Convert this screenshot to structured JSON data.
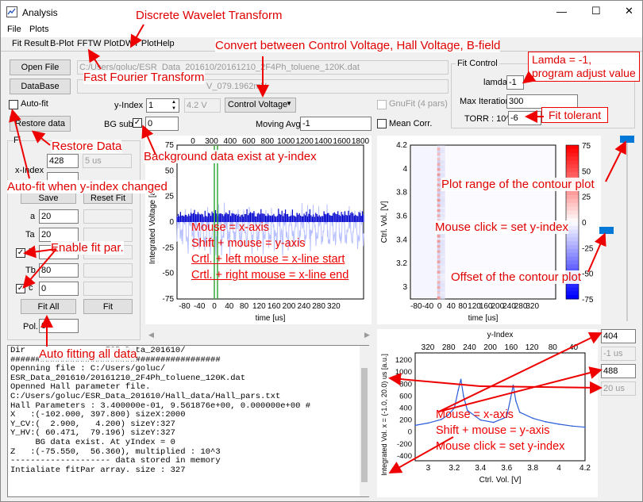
{
  "window": {
    "title": "Analysis",
    "minimize": "—",
    "maximize": "☐",
    "close": "✕"
  },
  "menu": [
    "File",
    "Plots"
  ],
  "tabs": [
    "Fit Result",
    "B-Plot",
    "FFTW Plot",
    "DWT Plot",
    "Help"
  ],
  "controls": {
    "open_file": "Open File",
    "open_file_path": "C:/Users/goluc/ESR_Data_201610/20161210_2F4Ph_toluene_120K.dat",
    "database": "DataBase",
    "database_text": "V_079.1962mV",
    "autofit": "Auto-fit",
    "restore_data": "Restore data",
    "y_index_label": "y-Index",
    "y_index_value": "1",
    "y_index_voltage": "4.2 V",
    "mode_select": "Control Voltage",
    "gnufit": "GnuFit (4 pars)",
    "bg_sub_label": "BG sub.",
    "bg_sub_value": "0",
    "moving_avg_label": "Moving Avg.",
    "moving_avg_value": "-1",
    "mean_corr": "Mean Corr.",
    "x_index_label": "x-Index",
    "x_index_value": "428",
    "x_index_time": "5 us",
    "save": "Save",
    "reset": "Reset Fit",
    "fit_panel_label": "Fi",
    "par_a_label": "a",
    "par_a": "20",
    "par_Ta_label": "Ta",
    "par_Ta": "20",
    "par_b_label": "b",
    "par_Tb_label": "Tb",
    "par_Tb": "80",
    "par_c_label": "c",
    "par_c": "0",
    "fit_all": "Fit All",
    "fit": "Fit",
    "pol_label": "Pol.",
    "pol_value": "0"
  },
  "fit_control": {
    "title": "Fit Control",
    "lamda_label": "lamda",
    "lamda_value": "-1",
    "max_iter_label": "Max Iteration",
    "max_iter_value": "300",
    "torr_label": "TORR : 10^",
    "torr_value": "-6"
  },
  "right_controls": {
    "top_value": "404",
    "top_time": "-1 us",
    "bottom_value": "488",
    "bottom_time": "20 us"
  },
  "log_lines": [
    "Dir                ESR_Data_201610/",
    "##########################################",
    "Openning file : C:/Users/goluc/",
    "ESR_Data_201610/20161210_2F4Ph_toluene_120K.dat",
    "Openned Hall parameter file.",
    "C:/Users/goluc/ESR_Data_201610/Hall_data/Hall_pars.txt",
    "Hall Parameters : 3.400000e-01, 9.561876e+00, 0.000000e+00 #",
    "X   :(-102.000, 397.800) sizeX:2000",
    "Y_CV:(  2.900,   4.200) sizeY:327",
    "Y_HV:( 60.471,  79.196) sizeY:327",
    "     BG data exist. At yIndex = 0",
    "Z   :(-75.550,  56.360), multiplied : 10^3",
    "-------------------- data stored in memory",
    "Intialiate fitPar array. size : 327"
  ],
  "annotations": {
    "dwt": "Discrete Wavelet Transform",
    "convert": "Convert between Control Voltage, Hall Voltage, B-field",
    "fft": "Fast Fourier Transform",
    "lamda": "Lamda = -1,\nprogram adjust value",
    "fit_tol": "Fit tolerant",
    "restore": "Restore Data",
    "bg_exist": "Background data exist at y-index",
    "autofit_change": "Auto-fit when y-index changed",
    "plot_range": "Plot range of the contour plot",
    "mouse_click": "Mouse click = set y-index",
    "enable_fit": "Enable fit par.",
    "offset": "Offset of the contour plot",
    "auto_all": "Auto fitting all data",
    "plot1_help": [
      "Mouse = x-axis",
      "Shift + mouse = y-axis",
      "Crtl. + left mouse = x-line start",
      "Crtl. + right mouse = x-line end"
    ],
    "plot3_help": [
      "Mouse = x-axis",
      "Shift + mouse = y-axis",
      "Mouse click = set y-index"
    ]
  },
  "chart_data": [
    {
      "type": "line",
      "xlabel": "time [us]",
      "ylabel": "Integrated Voltage [a.u.]",
      "x_ticks": [
        -80,
        -40,
        0,
        40,
        80,
        120,
        160,
        200,
        240,
        280,
        320
      ],
      "x2_ticks": [
        0,
        300,
        400,
        600,
        800,
        1000,
        1200,
        1400,
        1600,
        1800
      ],
      "y_ticks": [
        75,
        50,
        25,
        0,
        -25,
        -50,
        -75
      ],
      "xlim": [
        -100,
        400
      ],
      "ylim": [
        -75,
        75
      ],
      "series_color": "#0000cc"
    },
    {
      "type": "heatmap",
      "xlabel": "time [us]",
      "ylabel": "Ctrl. Vol. [V]",
      "x_ticks": [
        -80,
        -40,
        0,
        40,
        80,
        120,
        160,
        200,
        240,
        280,
        320
      ],
      "y_ticks": [
        4.2,
        4,
        3.8,
        3.6,
        3.4,
        3.2,
        3
      ],
      "colorbar_ticks": [
        75,
        50,
        25,
        0,
        -25,
        -50,
        -75
      ]
    },
    {
      "type": "line",
      "title": "y-Index",
      "xlabel": "Ctrl. Vol. [V]",
      "ylabel": "Integrated Vol. x = (-1.0, 20.0) us [a.u.]",
      "x_ticks": [
        3,
        3.2,
        3.4,
        3.6,
        3.8,
        4,
        4.2
      ],
      "x2_ticks": [
        320,
        280,
        240,
        200,
        160,
        120,
        80,
        40
      ],
      "y_ticks": [
        1200,
        1000,
        800,
        600,
        400,
        200,
        0,
        -200,
        -400
      ],
      "xlim": [
        2.9,
        4.2
      ],
      "ylim": [
        -480,
        1320
      ],
      "x": [
        2.9,
        3.0,
        3.1,
        3.15,
        3.2,
        3.23,
        3.25,
        3.27,
        3.3,
        3.4,
        3.5,
        3.6,
        3.63,
        3.65,
        3.67,
        3.7,
        3.8,
        3.9,
        4.0,
        4.1,
        4.2
      ],
      "y": [
        110,
        150,
        210,
        280,
        400,
        700,
        880,
        600,
        360,
        200,
        160,
        250,
        560,
        780,
        520,
        330,
        230,
        170,
        130,
        100,
        80
      ]
    }
  ]
}
